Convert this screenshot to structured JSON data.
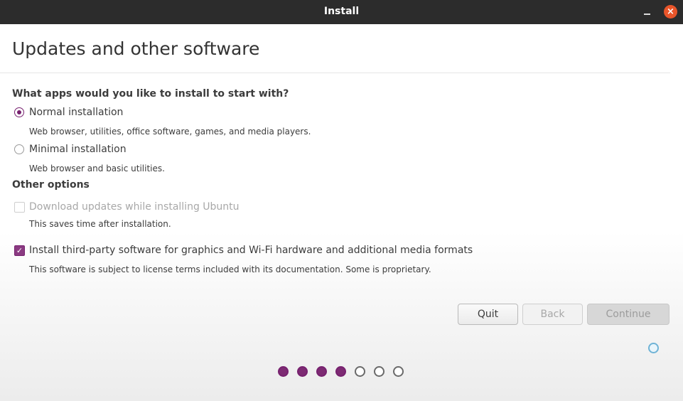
{
  "window": {
    "title": "Install",
    "close_glyph": "×"
  },
  "page": {
    "title": "Updates and other software"
  },
  "install_type": {
    "heading": "What apps would you like to install to start with?",
    "options": [
      {
        "label": "Normal installation",
        "description": "Web browser, utilities, office software, games, and media players.",
        "selected": true
      },
      {
        "label": "Minimal installation",
        "description": "Web browser and basic utilities.",
        "selected": false
      }
    ]
  },
  "other_options": {
    "heading": "Other options",
    "download_updates": {
      "label": "Download updates while installing Ubuntu",
      "description": "This saves time after installation.",
      "checked": false,
      "enabled": false
    },
    "third_party": {
      "label": "Install third-party software for graphics and Wi-Fi hardware and additional media formats",
      "description": "This software is subject to license terms included with its documentation. Some is proprietary.",
      "checked": true,
      "enabled": true,
      "check_glyph": "✓"
    }
  },
  "buttons": {
    "quit": "Quit",
    "back": "Back",
    "continue": "Continue"
  },
  "progress": {
    "total_steps": 7,
    "completed_steps": 4
  },
  "colors": {
    "accent": "#77216f",
    "close": "#e9552a",
    "titlebar": "#2c2c2c"
  },
  "icons": {
    "close": "close-icon",
    "minimize": "minimize-icon",
    "busy_cursor": "busy-cursor-icon"
  }
}
